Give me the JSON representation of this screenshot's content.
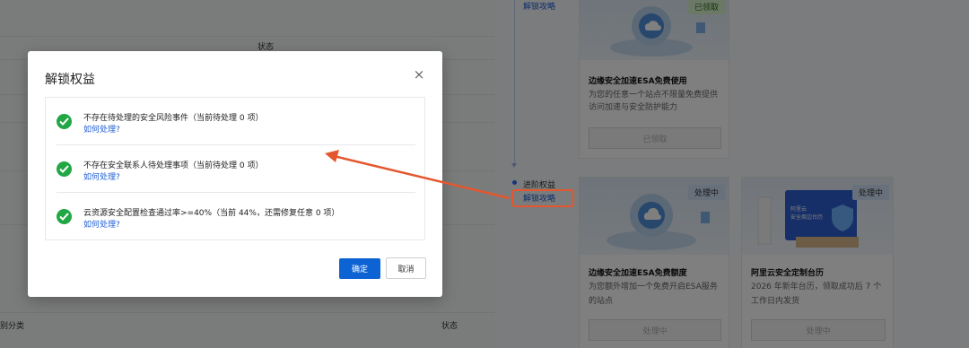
{
  "background": {
    "table_header_status": "状态",
    "table2_header_category": "别分类",
    "table2_header_status": "状态"
  },
  "timeline": {
    "top_link": "解锁攻略",
    "stage_label": "进阶权益",
    "stage_link": "解锁攻略"
  },
  "cards": {
    "top": {
      "tag": "已领取",
      "title": "边缘安全加速ESA免费使用",
      "desc_line1": "为您的任意一个站点不限量免费提供",
      "desc_line2": "访问加速与安全防护能力",
      "button": "已领取"
    },
    "esa_quota": {
      "tag": "处理中",
      "title": "边缘安全加速ESA免费额度",
      "desc_line1": "为您额外增加一个免费开启ESA服务",
      "desc_line2": "的站点",
      "button": "处理中"
    },
    "calendar": {
      "tag": "处理中",
      "image_text_line1": "阿里云",
      "image_text_line2": "安全周边台历",
      "title": "阿里云安全定制台历",
      "desc_line1": "2026 年新年台历，领取成功后 7 个",
      "desc_line2": "工作日内发货",
      "button": "处理中"
    }
  },
  "modal": {
    "title": "解锁权益",
    "close_label": "×",
    "items": [
      {
        "text": "不存在待处理的安全风险事件（当前待处理 0 项）",
        "link": "如何处理?"
      },
      {
        "text": "不存在安全联系人待处理事项（当前待处理 0 项）",
        "link": "如何处理?"
      },
      {
        "text": "云资源安全配置检查通过率>=40%（当前 44%，还需修复任意 0 项）",
        "link": "如何处理?"
      }
    ],
    "ok_label": "确定",
    "cancel_label": "取消"
  },
  "colors": {
    "primary": "#0d63d3",
    "success": "#22a745",
    "annotation": "#e4572e"
  }
}
